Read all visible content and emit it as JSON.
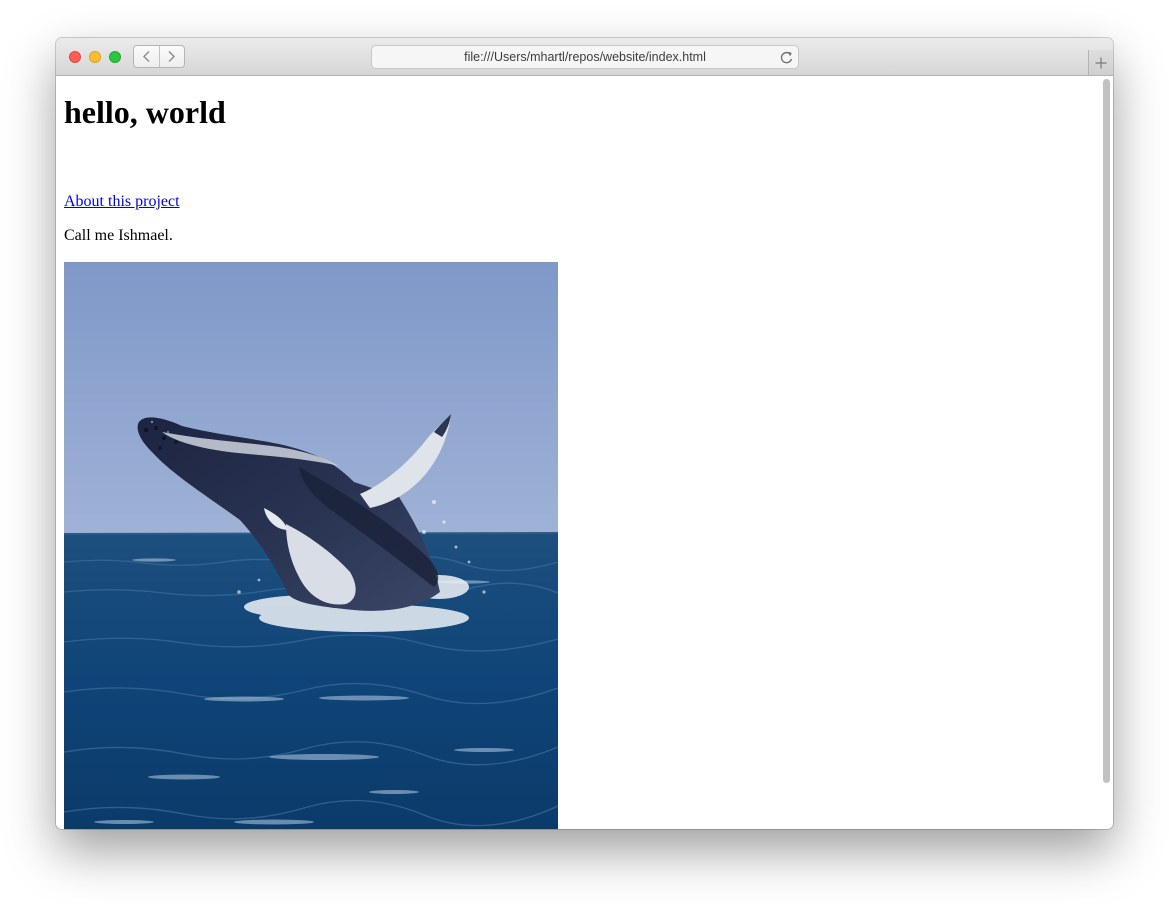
{
  "browser": {
    "address_url": "file:///Users/mhartl/repos/website/index.html",
    "controls": {
      "close": "close-button",
      "minimize": "minimize-button",
      "zoom": "zoom-button",
      "back": "chevron-left-icon",
      "forward": "chevron-right-icon",
      "reload": "reload-icon",
      "new_tab": "plus-icon"
    }
  },
  "page": {
    "heading": "hello, world",
    "about_link": "About this project",
    "intro": "Call me Ishmael.",
    "image_subject": "breaching-humpback-whale"
  },
  "colors": {
    "link": "#0000ee",
    "sky": "#8fa6cf",
    "sea": "#0b3f73",
    "close": "#fd5f57",
    "minimize": "#febc2e",
    "zoom": "#28c840"
  }
}
